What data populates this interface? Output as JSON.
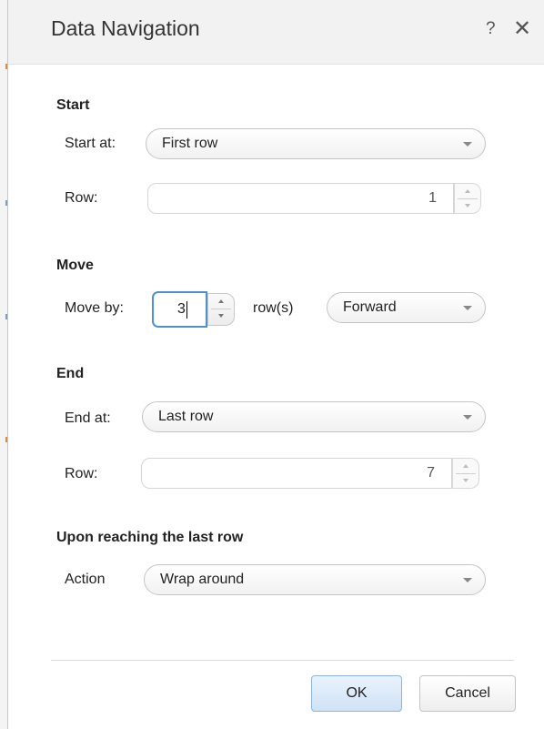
{
  "dialog": {
    "title": "Data Navigation",
    "help_glyph": "?",
    "close_glyph": "✕"
  },
  "start": {
    "heading": "Start",
    "start_at_label": "Start at:",
    "start_at_value": "First row",
    "row_label": "Row:",
    "row_value": "1"
  },
  "move": {
    "heading": "Move",
    "move_by_label": "Move by:",
    "move_by_value": "3",
    "rows_label": "row(s)",
    "direction_value": "Forward"
  },
  "end": {
    "heading": "End",
    "end_at_label": "End at:",
    "end_at_value": "Last row",
    "row_label": "Row:",
    "row_value": "7"
  },
  "last_row": {
    "heading": "Upon reaching the last row",
    "action_label": "Action",
    "action_value": "Wrap around"
  },
  "buttons": {
    "ok": "OK",
    "cancel": "Cancel"
  },
  "colors": {
    "focus_border": "#4f90cf",
    "ok_button_bg": "#cfe2f6",
    "titlebar_bg": "#f2f2f2"
  },
  "icons": {
    "help": "help-icon",
    "close": "close-icon",
    "dropdown": "chevron-down-icon",
    "spinner_up": "spinner-up-icon",
    "spinner_down": "spinner-down-icon"
  }
}
